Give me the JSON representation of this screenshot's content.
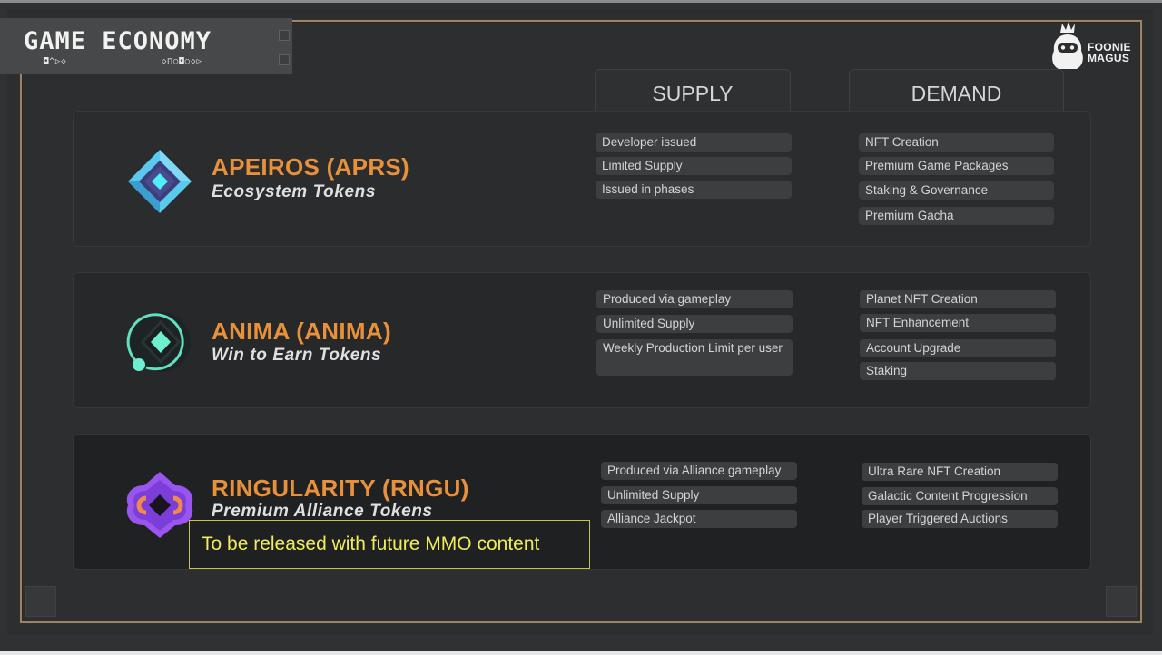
{
  "header": {
    "title": "GAME ECONOMY",
    "title_glyphs_left": "◘^▷◇",
    "title_glyphs_right": "◇⊓○◘○◇▷",
    "brand_line1": "FOONIE",
    "brand_line2": "MAGUS"
  },
  "columns": {
    "supply_label": "SUPPLY",
    "demand_label": "DEMAND"
  },
  "tokens": [
    {
      "name": "APEIROS (APRS)",
      "subtitle": "Ecosystem Tokens",
      "icon": "diamond-crystal-icon",
      "supply": [
        "Developer issued",
        "Limited Supply",
        "Issued in phases"
      ],
      "demand": [
        "NFT Creation",
        "Premium Game Packages",
        "Staking & Governance",
        "Premium Gacha"
      ]
    },
    {
      "name": "ANIMA (ANIMA)",
      "subtitle": "Win to Earn Tokens",
      "icon": "orbit-diamond-icon",
      "supply": [
        "Produced via gameplay",
        "Unlimited Supply",
        "Weekly Production Limit per user"
      ],
      "demand": [
        "Planet NFT Creation",
        "NFT Enhancement",
        "Account Upgrade",
        "Staking"
      ]
    },
    {
      "name": "RINGULARITY (RNGU)",
      "subtitle": "Premium Alliance Tokens",
      "icon": "ring-knot-icon",
      "supply": [
        "Produced via Alliance gameplay",
        "Unlimited Supply",
        "Alliance Jackpot"
      ],
      "demand": [
        "Ultra Rare NFT Creation",
        "Galactic Content Progression",
        "Player Triggered Auctions"
      ],
      "notice": "To be released with future MMO content"
    }
  ],
  "colors": {
    "token_name": "#e8903a",
    "notice_text": "#f0ec5a",
    "frame_gold": "#9a8468",
    "aprs_crystal": "#5bc8ee",
    "anima_accent": "#5fe0c0",
    "rngu_accent": "#a05cf0"
  }
}
